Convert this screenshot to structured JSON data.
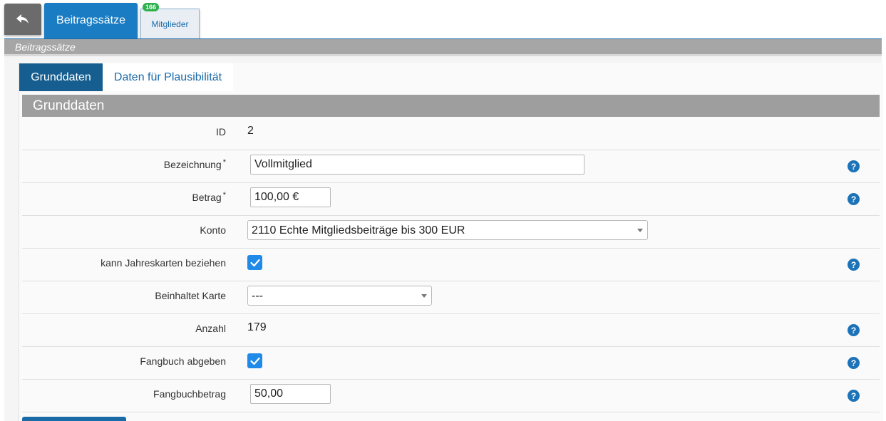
{
  "nav": {
    "back_icon": "reply-arrow-icon",
    "main_tab": "Beitragssätze",
    "secondary_tab": "Mitglieder",
    "badge_count": "166"
  },
  "section": {
    "title": "Beitragssätze"
  },
  "subtabs": [
    {
      "label": "Grunddaten",
      "active": true
    },
    {
      "label": "Daten für Plausibilität",
      "active": false
    }
  ],
  "group": {
    "title": "Grunddaten"
  },
  "form": {
    "id": {
      "label": "ID",
      "value": "2"
    },
    "bezeichnung": {
      "label": "Bezeichnung",
      "required": "*",
      "value": "Vollmitglied"
    },
    "betrag": {
      "label": "Betrag",
      "required": "*",
      "value": "100,00 €"
    },
    "konto": {
      "label": "Konto",
      "value": "2110 Echte Mitgliedsbeiträge bis 300 EUR"
    },
    "jahreskarten": {
      "label": "kann Jahreskarten beziehen",
      "checked": true
    },
    "karte": {
      "label": "Beinhaltet Karte",
      "value": "---"
    },
    "anzahl": {
      "label": "Anzahl",
      "value": "179"
    },
    "fangbuch": {
      "label": "Fangbuch abgeben",
      "checked": true
    },
    "fangbuchbetrag": {
      "label": "Fangbuchbetrag",
      "value": "50,00"
    }
  },
  "help_icon": "?",
  "colors": {
    "primary": "#1a7cc2",
    "active_subtab": "#155e8f",
    "checkbox": "#1f8ae8",
    "badge": "#2bb04a",
    "header_gray": "#9e9e9e"
  }
}
